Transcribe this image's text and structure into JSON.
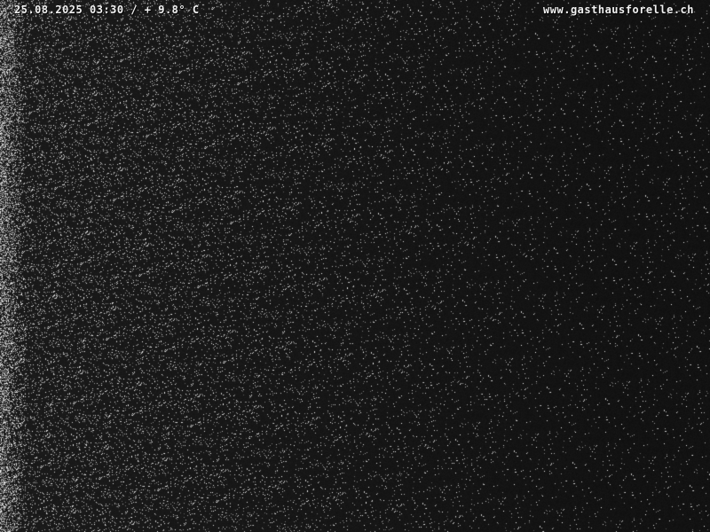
{
  "webcam": {
    "timestamp_text": "25.08.2025 03:30 / + 9.8° C",
    "website_text": "www.gasthausforelle.ch",
    "background_color": "#121212",
    "noise_color": "#ffffff"
  }
}
